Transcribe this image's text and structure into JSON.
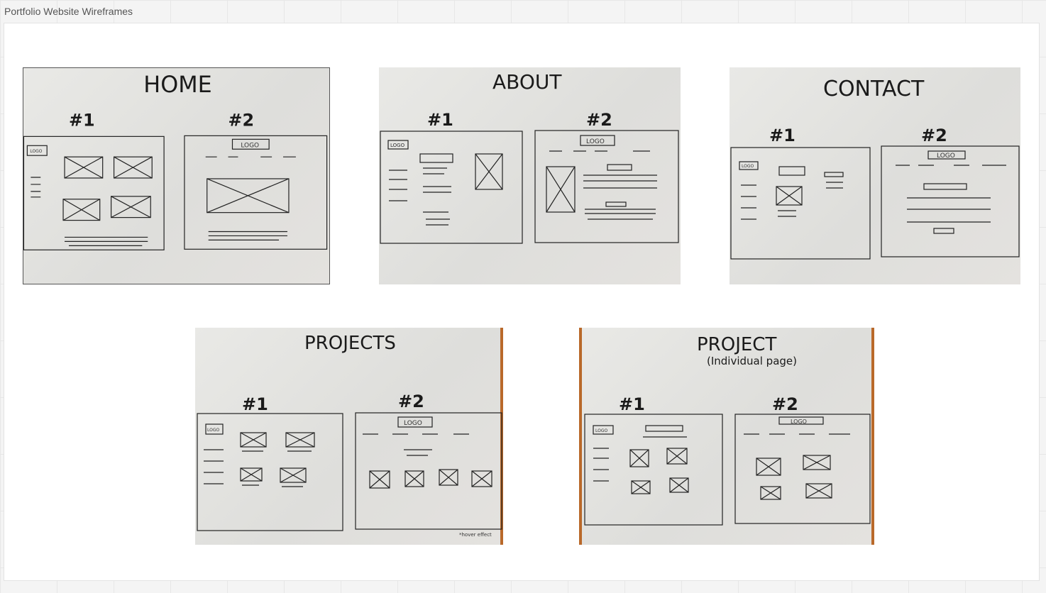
{
  "board": {
    "title": "Portfolio Website Wireframes"
  },
  "sketches": [
    {
      "id": "home",
      "title": "HOME",
      "version_1": "#1",
      "version_2": "#2",
      "logo_text": "LOGO"
    },
    {
      "id": "about",
      "title": "ABOUT",
      "version_1": "#1",
      "version_2": "#2",
      "logo_text": "LOGO"
    },
    {
      "id": "contact",
      "title": "CONTACT",
      "version_1": "#1",
      "version_2": "#2",
      "logo_text": "LOGO"
    },
    {
      "id": "projects",
      "title": "PROJECTS",
      "version_1": "#1",
      "version_2": "#2",
      "logo_text": "LOGO",
      "note": "*hover effect"
    },
    {
      "id": "project",
      "title": "PROJECT",
      "subtitle": "(Individual page)",
      "version_1": "#1",
      "version_2": "#2",
      "logo_text": "LOGO"
    }
  ]
}
